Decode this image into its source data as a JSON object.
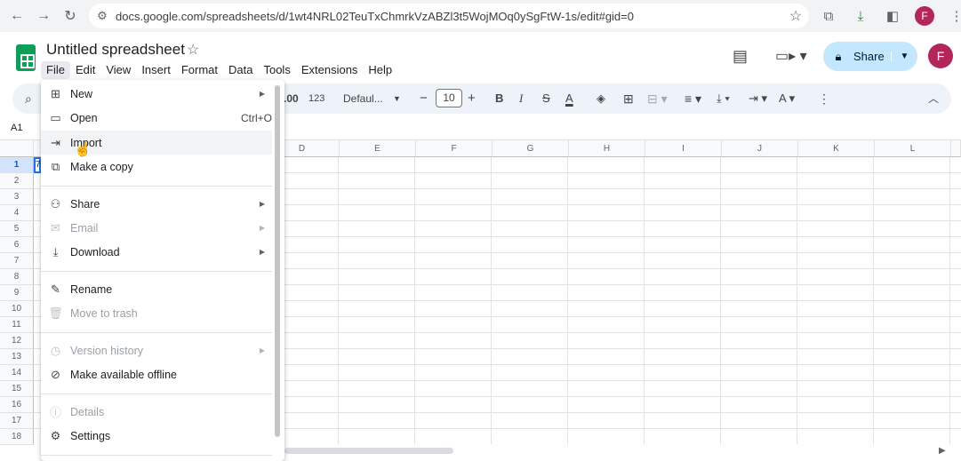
{
  "browser": {
    "url": "docs.google.com/spreadsheets/d/1wt4NRL02TeuTxChmrkVzABZl3t5WojMOq0ySgFtW-1s/edit#gid=0",
    "profile_initial": "F"
  },
  "header": {
    "title": "Untitled spreadsheet",
    "share_label": "Share",
    "avatar_initial": "F"
  },
  "menubar": [
    "File",
    "Edit",
    "View",
    "Insert",
    "Format",
    "Data",
    "Tools",
    "Extensions",
    "Help"
  ],
  "toolbar": {
    "decimal_more": ".00",
    "number_format": "123",
    "font": "Defaul...",
    "font_size": "10"
  },
  "formula_bar": {
    "cell_ref": "A1"
  },
  "grid": {
    "columns": [
      "D",
      "E",
      "F",
      "G",
      "H",
      "I",
      "J",
      "K",
      "L"
    ],
    "rows": [
      "1",
      "2",
      "3",
      "4",
      "5",
      "6",
      "7",
      "8",
      "9",
      "10",
      "11",
      "12",
      "13",
      "14",
      "15",
      "16",
      "17",
      "18"
    ],
    "a1_fragment": "7"
  },
  "file_menu": {
    "items": [
      {
        "label": "New",
        "icon": "plus-icon",
        "arrow": true,
        "disabled": false
      },
      {
        "label": "Open",
        "icon": "folder-icon",
        "shortcut": "Ctrl+O",
        "disabled": false
      },
      {
        "label": "Import",
        "icon": "import-icon",
        "disabled": false
      },
      {
        "label": "Make a copy",
        "icon": "copy-icon",
        "disabled": false
      },
      {
        "label": "Share",
        "icon": "person-add-icon",
        "arrow": true,
        "disabled": false
      },
      {
        "label": "Email",
        "icon": "mail-icon",
        "arrow": true,
        "disabled": true
      },
      {
        "label": "Download",
        "icon": "download-icon",
        "arrow": true,
        "disabled": false
      },
      {
        "label": "Rename",
        "icon": "pencil-icon",
        "disabled": false
      },
      {
        "label": "Move to trash",
        "icon": "trash-icon",
        "disabled": true
      },
      {
        "label": "Version history",
        "icon": "history-icon",
        "arrow": true,
        "disabled": true
      },
      {
        "label": "Make available offline",
        "icon": "offline-check-icon",
        "disabled": false
      },
      {
        "label": "Details",
        "icon": "info-icon",
        "disabled": true
      },
      {
        "label": "Settings",
        "icon": "gear-icon",
        "disabled": false
      }
    ]
  }
}
